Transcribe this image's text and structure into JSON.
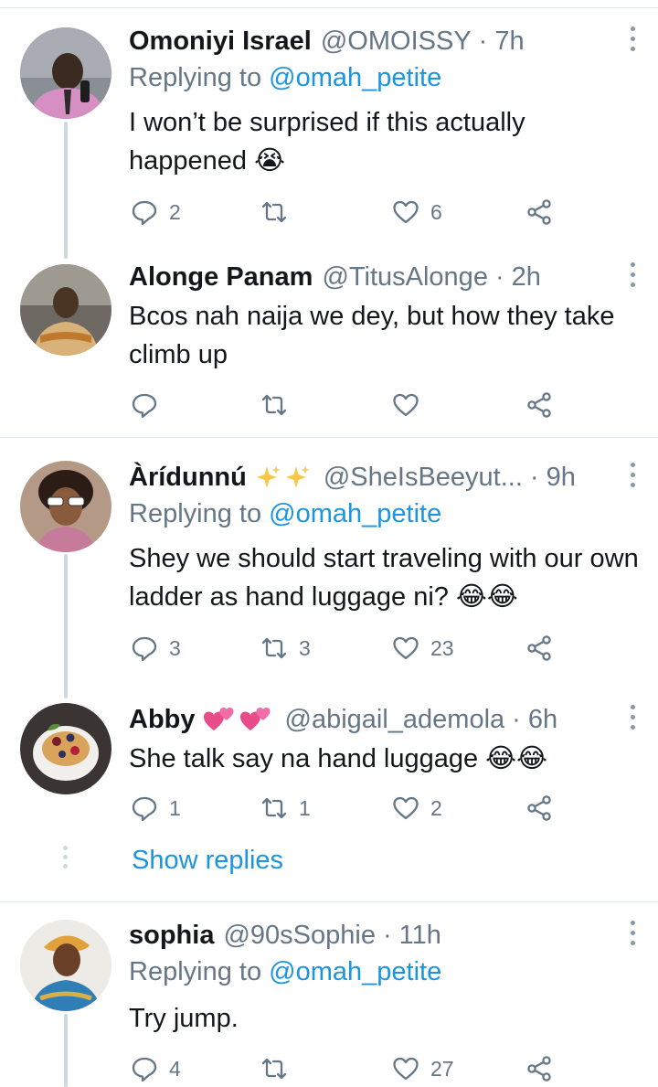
{
  "tweets": [
    {
      "name": "Omoniyi Israel",
      "handle": "@OMOISSY",
      "time": "· 7h",
      "replying_prefix": "Replying to ",
      "replying_mention": "@omah_petite",
      "text": "I won’t be surprised if this actually happened 😭",
      "counts": {
        "reply": "2",
        "retweet": "",
        "like": "6"
      }
    },
    {
      "name": "Alonge Panam",
      "handle": "@TitusAlonge",
      "time": "· 2h",
      "text": "Bcos nah naija we dey, but how they take climb up",
      "counts": {
        "reply": "",
        "retweet": "",
        "like": ""
      }
    },
    {
      "name": "Àrídunnú",
      "handle": "@SheIsBeeyut...",
      "time": "· 9h",
      "replying_prefix": "Replying to ",
      "replying_mention": "@omah_petite",
      "text": "Shey we should start traveling with our own ladder as hand luggage ni? 😂😂",
      "counts": {
        "reply": "3",
        "retweet": "3",
        "like": "23"
      }
    },
    {
      "name": "Abby",
      "handle": "@abigail_ademola",
      "time": "· 6h",
      "text": "She talk say na hand luggage 😂😂",
      "counts": {
        "reply": "1",
        "retweet": "1",
        "like": "2"
      }
    },
    {
      "name": "sophia",
      "handle": "@90sSophie",
      "time": "· 11h",
      "replying_prefix": "Replying to ",
      "replying_mention": "@omah_petite",
      "text": "Try jump.",
      "counts": {
        "reply": "4",
        "retweet": "",
        "like": "27"
      }
    }
  ],
  "show_replies": "Show replies",
  "icons": {
    "reply": "reply-icon",
    "retweet": "retweet-icon",
    "like": "heart-icon",
    "share": "share-icon",
    "more": "more-vertical-icon",
    "sparkles": "sparkles-emoji",
    "hearts": "two-hearts-emoji"
  },
  "colors": {
    "link": "#1b95e0",
    "secondary": "#657786",
    "text": "#14171a",
    "divider": "#e1e8ed",
    "thread": "#cfd9de"
  }
}
